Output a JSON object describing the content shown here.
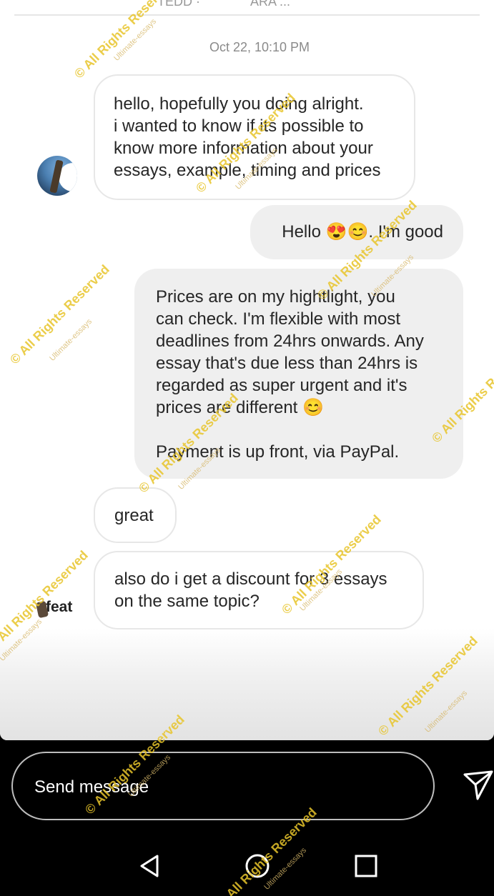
{
  "header": {
    "partial_left": "TEDD ·",
    "partial_right": "ARA ..."
  },
  "conversation": {
    "timestamp": "Oct 22, 10:10 PM",
    "messages": [
      {
        "sender": "other",
        "text": "hello, hopefully you doing alright.\ni wanted to know if its possible to\nknow more information about your\nessays, example, timing and prices"
      },
      {
        "sender": "me",
        "text": "Hello 😍😊. I'm good"
      },
      {
        "sender": "me",
        "text": "Prices are on my hightlight, you\ncan check. I'm flexible with most\ndeadlines from 24hrs onwards. Any\nessay that's due less than 24hrs is\nregarded as super urgent and it's\nprices are different 😊\n\nPayment is up front, via PayPal."
      },
      {
        "sender": "other",
        "text": "great"
      },
      {
        "sender": "other",
        "text": "also do i get a discount for 3 essays\non the same topic?"
      }
    ],
    "sticker_text": "feat"
  },
  "composer": {
    "placeholder": "Send message"
  },
  "watermark": {
    "main": "© All Rights Reserved",
    "sub": "Ultimate-essays"
  },
  "icons": {
    "send": "send-paper-plane-icon",
    "back": "back-triangle-icon",
    "home": "home-circle-icon",
    "recents": "recents-square-icon"
  },
  "colors": {
    "incoming_bubble_border": "#e7e7e7",
    "outgoing_bubble_bg": "#efefef",
    "watermark": "#e8c52b",
    "bottom_bar": "#000000"
  }
}
